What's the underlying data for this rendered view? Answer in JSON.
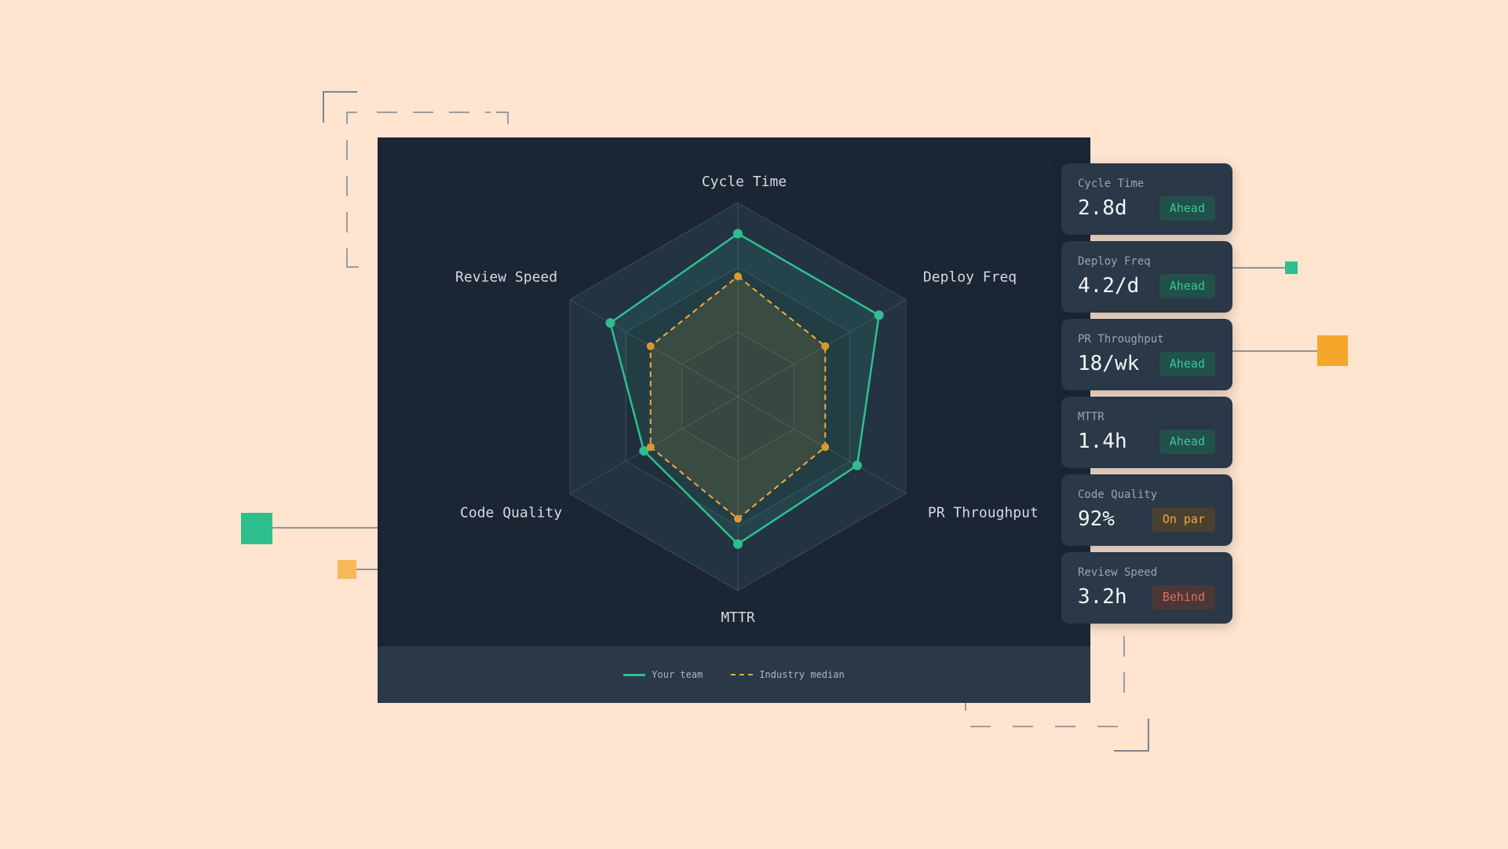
{
  "colors": {
    "background": "#FFE4CF",
    "panel": "#1B2533",
    "team": "#2FBF8F",
    "median": "#F2A93B",
    "ahead": "#39C796",
    "on_par": "#F2A93B",
    "behind": "#E76E58"
  },
  "legend": {
    "team_label": "Your team",
    "median_label": "Industry median"
  },
  "chart_data": {
    "type": "radar",
    "axes": [
      "Cycle Time",
      "Deploy Freq",
      "PR Throughput",
      "MTTR",
      "Code Quality",
      "Review Speed"
    ],
    "range": [
      0,
      100
    ],
    "rings": 3,
    "grid": true,
    "legend_position": "bottom",
    "series": [
      {
        "name": "Your team",
        "values": [
          84,
          84,
          71,
          76,
          56,
          76
        ],
        "style": "solid"
      },
      {
        "name": "Industry median",
        "values": [
          62,
          52,
          52,
          63,
          52,
          52
        ],
        "style": "dashed"
      }
    ]
  },
  "metrics": [
    {
      "label": "Cycle Time",
      "value": "2.8d",
      "status": "Ahead",
      "status_key": "ahead"
    },
    {
      "label": "Deploy Freq",
      "value": "4.2/d",
      "status": "Ahead",
      "status_key": "ahead"
    },
    {
      "label": "PR Throughput",
      "value": "18/wk",
      "status": "Ahead",
      "status_key": "ahead"
    },
    {
      "label": "MTTR",
      "value": "1.4h",
      "status": "Ahead",
      "status_key": "ahead"
    },
    {
      "label": "Code Quality",
      "value": "92%",
      "status": "On par",
      "status_key": "onpar"
    },
    {
      "label": "Review Speed",
      "value": "3.2h",
      "status": "Behind",
      "status_key": "behind"
    }
  ]
}
